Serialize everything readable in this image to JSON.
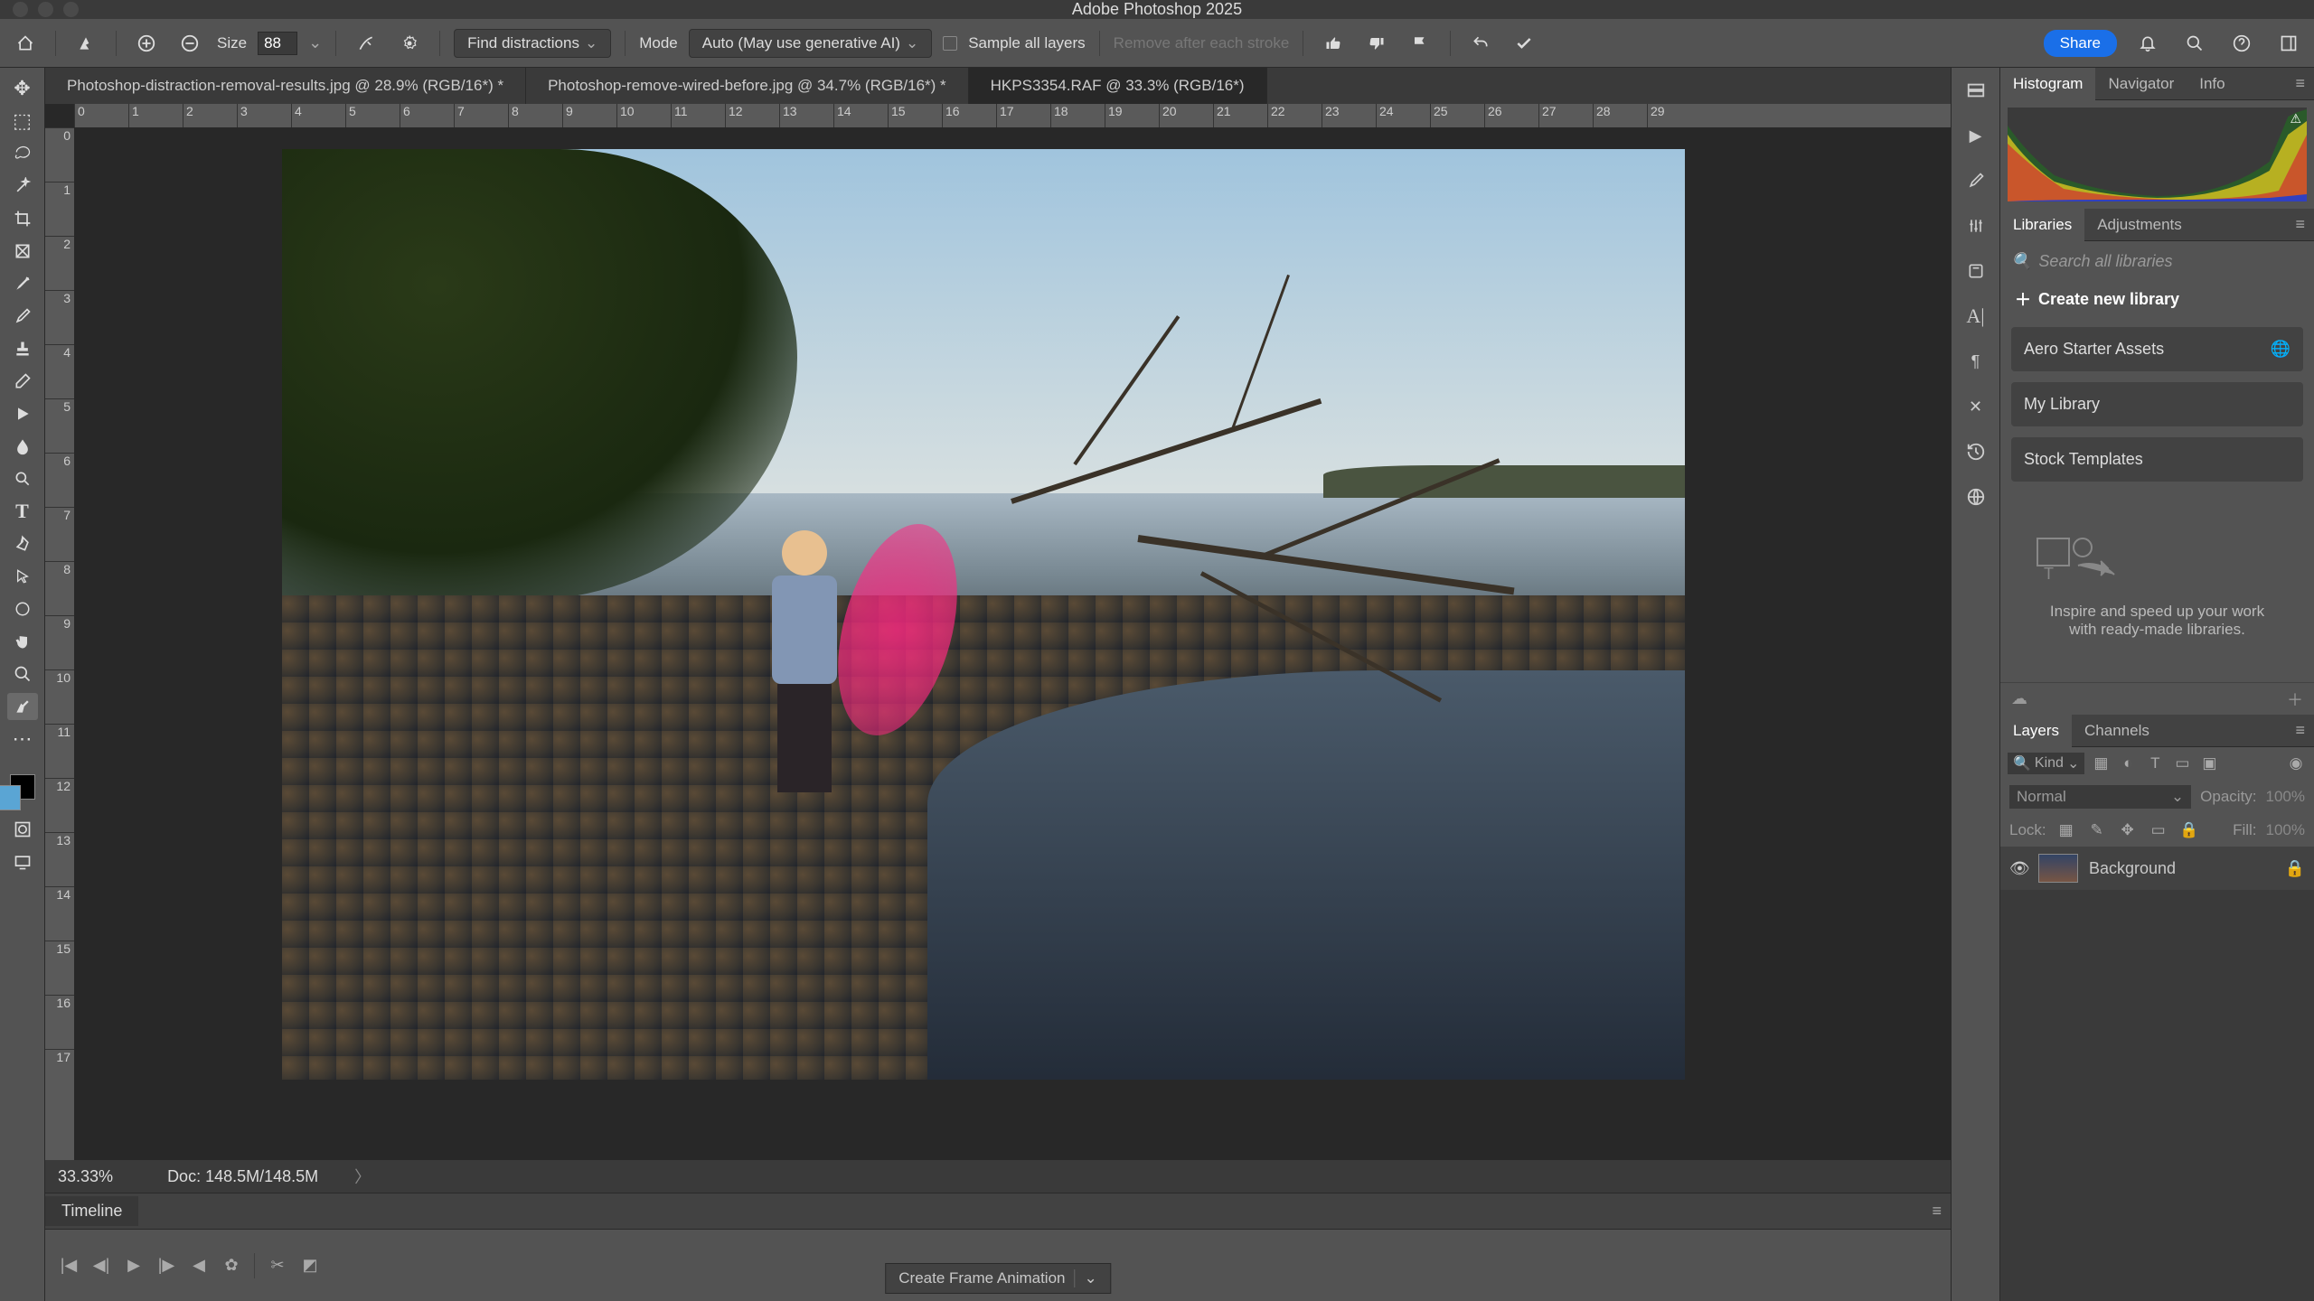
{
  "app": {
    "title": "Adobe Photoshop 2025"
  },
  "optionsBar": {
    "sizeLabel": "Size",
    "sizeValue": "88",
    "findDistractions": "Find distractions",
    "modeLabel": "Mode",
    "modeValue": "Auto (May use generative AI)",
    "sampleAll": "Sample all layers",
    "removeAfter": "Remove after each stroke",
    "share": "Share"
  },
  "tabs": [
    "Photoshop-distraction-removal-results.jpg @ 28.9% (RGB/16*) *",
    "Photoshop-remove-wired-before.jpg @ 34.7% (RGB/16*) *",
    "HKPS3354.RAF @ 33.3% (RGB/16*)"
  ],
  "rulerH": [
    "0",
    "1",
    "2",
    "3",
    "4",
    "5",
    "6",
    "7",
    "8",
    "9",
    "10",
    "11",
    "12",
    "13",
    "14",
    "15",
    "16",
    "17",
    "18",
    "19",
    "20",
    "21",
    "22",
    "23",
    "24",
    "25",
    "26",
    "27",
    "28",
    "29"
  ],
  "rulerV": [
    "0",
    "1",
    "2",
    "3",
    "4",
    "5",
    "6",
    "7",
    "8",
    "9",
    "10",
    "11",
    "12",
    "13",
    "14",
    "15",
    "16",
    "17"
  ],
  "status": {
    "zoom": "33.33%",
    "doc": "Doc: 148.5M/148.5M"
  },
  "timeline": {
    "tab": "Timeline",
    "createFrame": "Create Frame Animation"
  },
  "panels": {
    "top": {
      "tabs": [
        "Histogram",
        "Navigator",
        "Info"
      ]
    },
    "mid": {
      "tabs": [
        "Libraries",
        "Adjustments"
      ],
      "searchPlaceholder": "Search all libraries",
      "createNew": "Create new library",
      "items": [
        "Aero Starter Assets",
        "My Library",
        "Stock Templates"
      ],
      "promo1": "Inspire and speed up your work",
      "promo2": "with ready-made libraries."
    },
    "layers": {
      "tabs": [
        "Layers",
        "Channels"
      ],
      "kind": "Kind",
      "blend": "Normal",
      "opacityLabel": "Opacity:",
      "opacityVal": "100%",
      "lockLabel": "Lock:",
      "fillLabel": "Fill:",
      "fillVal": "100%",
      "bgLayer": "Background"
    }
  }
}
